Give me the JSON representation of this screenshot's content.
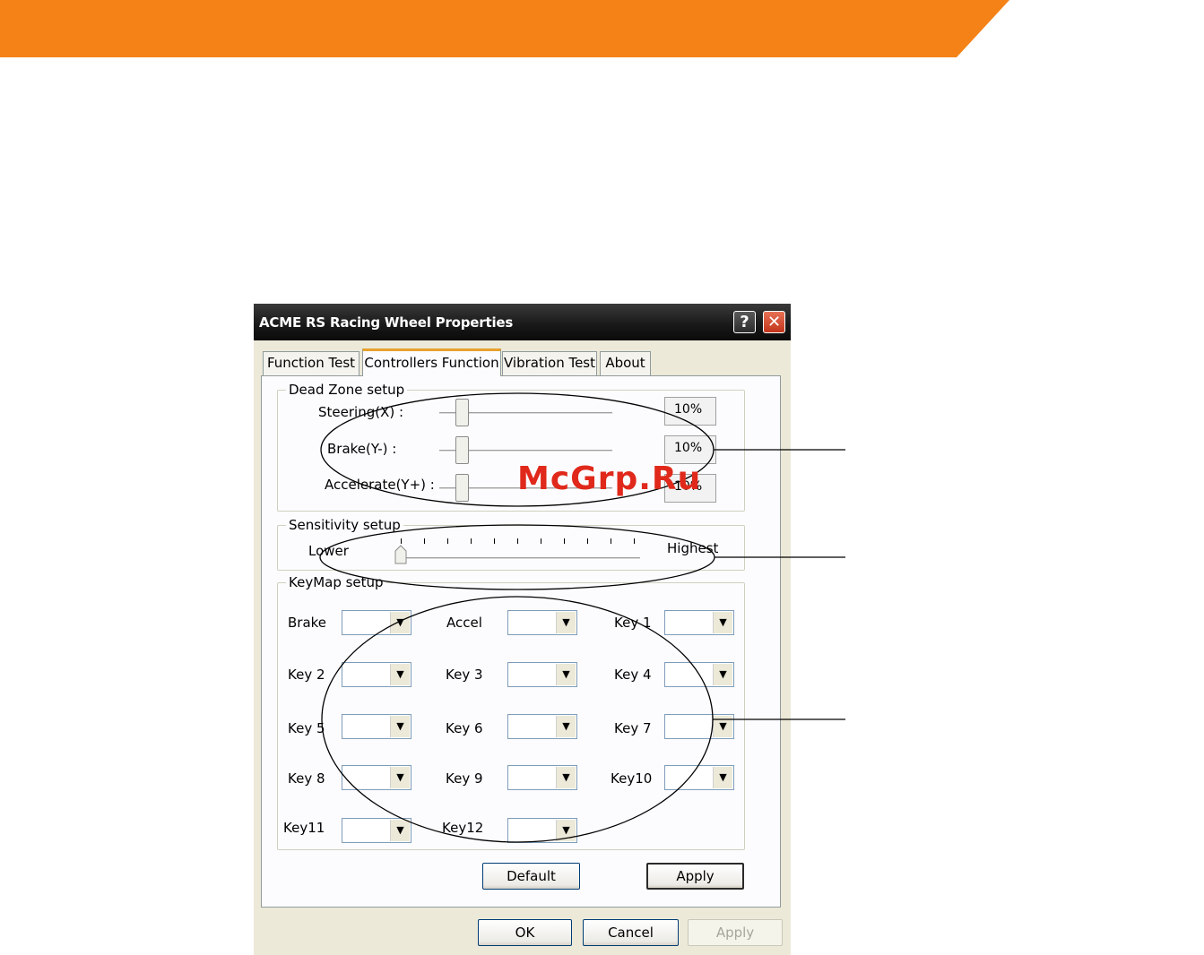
{
  "banner": {
    "color": "#f58216"
  },
  "window": {
    "title": "ACME RS Racing Wheel Properties",
    "help_icon": "?",
    "close_icon": "✕"
  },
  "tabs": [
    {
      "label": "Function Test",
      "active": false
    },
    {
      "label": "Controllers Function",
      "active": true
    },
    {
      "label": "Vibration Test",
      "active": false
    },
    {
      "label": "About",
      "active": false
    }
  ],
  "dead_zone": {
    "title": "Dead Zone setup",
    "rows": [
      {
        "label": "Steering(X) :",
        "value": "10%"
      },
      {
        "label": "Brake(Y-) :",
        "value": "10%"
      },
      {
        "label": "Accelerate(Y+) :",
        "value": "10%"
      }
    ]
  },
  "sensitivity": {
    "title": "Sensitivity setup",
    "low_label": "Lower",
    "high_label": "Highest",
    "level_fraction": 0
  },
  "keymap": {
    "title": "KeyMap setup",
    "items": [
      {
        "label": "Brake"
      },
      {
        "label": "Accel"
      },
      {
        "label": "Key 1"
      },
      {
        "label": "Key 2"
      },
      {
        "label": "Key 3"
      },
      {
        "label": "Key 4"
      },
      {
        "label": "Key 5"
      },
      {
        "label": "Key 6"
      },
      {
        "label": "Key 7"
      },
      {
        "label": "Key 8"
      },
      {
        "label": "Key 9"
      },
      {
        "label": "Key10"
      },
      {
        "label": "Key11"
      },
      {
        "label": "Key12"
      }
    ]
  },
  "panel_buttons": {
    "default_label": "Default",
    "apply_label": "Apply"
  },
  "dialog_buttons": {
    "ok_label": "OK",
    "cancel_label": "Cancel",
    "apply_label": "Apply"
  },
  "watermark": "McGrp.Ru"
}
